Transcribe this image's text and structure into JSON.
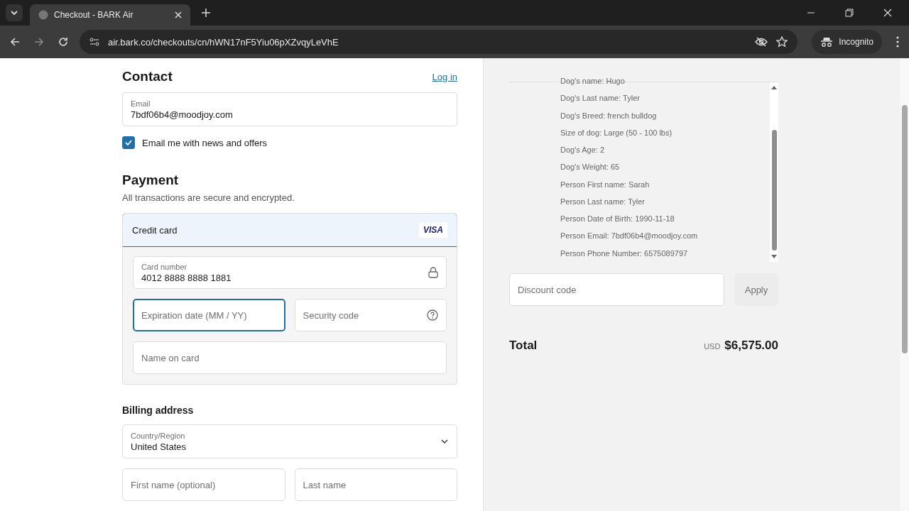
{
  "browser": {
    "tab_title": "Checkout - BARK Air",
    "url": "air.bark.co/checkouts/cn/hWN17nF5Yiu06pXZvqyLeVhE",
    "profile": "Incognito"
  },
  "contact": {
    "heading": "Contact",
    "login_link": "Log in",
    "email": {
      "label": "Email",
      "value": "7bdf06b4@moodjoy.com"
    },
    "newsletter": {
      "label": "Email me with news and offers",
      "checked": true
    }
  },
  "payment": {
    "heading": "Payment",
    "subtitle": "All transactions are secure and encrypted.",
    "method": {
      "label": "Credit card",
      "selected": true,
      "brand": "VISA"
    },
    "fields": [
      {
        "label": "Card number",
        "value": "4012 8888 8888 1881",
        "focused": false
      },
      {
        "placeholder": "Expiration date (MM / YY)",
        "focused": true
      },
      {
        "placeholder": "Security code",
        "focused": false
      },
      {
        "placeholder": "Name on card",
        "focused": false
      }
    ]
  },
  "billing": {
    "heading": "Billing address",
    "country": {
      "label": "Country/Region",
      "value": "United States"
    },
    "first_name": {
      "placeholder": "First name (optional)"
    },
    "last_name": {
      "placeholder": "Last name"
    }
  },
  "summary": {
    "details": [
      "Dog's name: Hugo",
      "Dog's Last name: Tyler",
      "Dog's Breed: french bulldog",
      "Size of dog: Large (50 - 100 lbs)",
      "Dog's Age: 2",
      "Dog's Weight: 65",
      "Person First name: Sarah",
      "Person Last name: Tyler",
      "Person Date of Birth: 1990-11-18",
      "Person Email: 7bdf06b4@moodjoy.com",
      "Person Phone Number: 6575089797"
    ],
    "discount": {
      "placeholder": "Discount code",
      "button": "Apply"
    },
    "total": {
      "label": "Total",
      "currency": "USD",
      "amount": "$6,575.00"
    }
  }
}
